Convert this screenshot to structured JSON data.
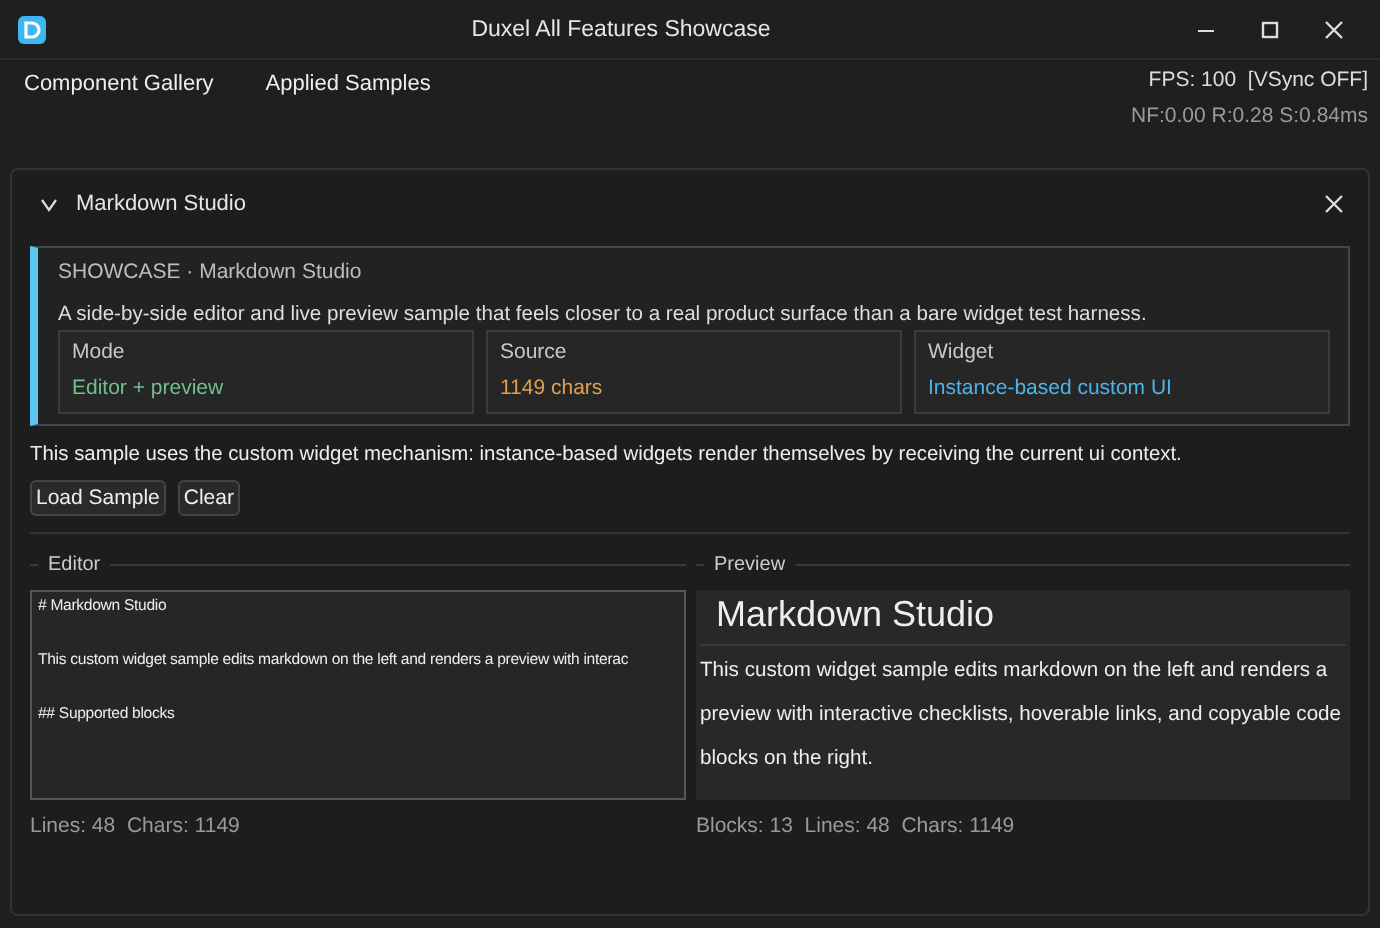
{
  "window": {
    "title": "Duxel All Features Showcase"
  },
  "menu": [
    {
      "label": "Component Gallery"
    },
    {
      "label": "Applied Samples"
    }
  ],
  "stats": {
    "fps": "FPS: 100  [VSync OFF]",
    "timings": "NF:0.00 R:0.28 S:0.84ms"
  },
  "panel": {
    "title": "Markdown Studio",
    "expanded": true,
    "showcase": {
      "heading": "SHOWCASE · Markdown Studio",
      "description": "A side-by-side editor and live preview sample that feels closer to a real product surface than a bare widget test harness.",
      "cards": [
        {
          "label": "Mode",
          "value": "Editor + preview",
          "color": "#6fbf8f"
        },
        {
          "label": "Source",
          "value": "1149 chars",
          "color": "#e0a050"
        },
        {
          "label": "Widget",
          "value": "Instance-based custom UI",
          "color": "#4fb3e8"
        }
      ]
    },
    "info": "This sample uses the custom widget mechanism: instance-based widgets render themselves by receiving the current ui context.",
    "buttons": [
      {
        "label": "Load Sample"
      },
      {
        "label": "Clear"
      }
    ],
    "editor": {
      "title": "Editor",
      "lines": [
        "# Markdown Studio",
        "This custom widget sample edits markdown on the left and renders a preview with interac",
        "## Supported blocks"
      ],
      "status": "Lines: 48  Chars: 1149"
    },
    "preview": {
      "title": "Preview",
      "heading": "Markdown Studio",
      "paragraph": "This custom widget sample edits markdown on the left and renders a preview with interactive checklists, hoverable links, and copyable code blocks on the right.",
      "status": "Blocks: 13  Lines: 48  Chars: 1149"
    }
  }
}
